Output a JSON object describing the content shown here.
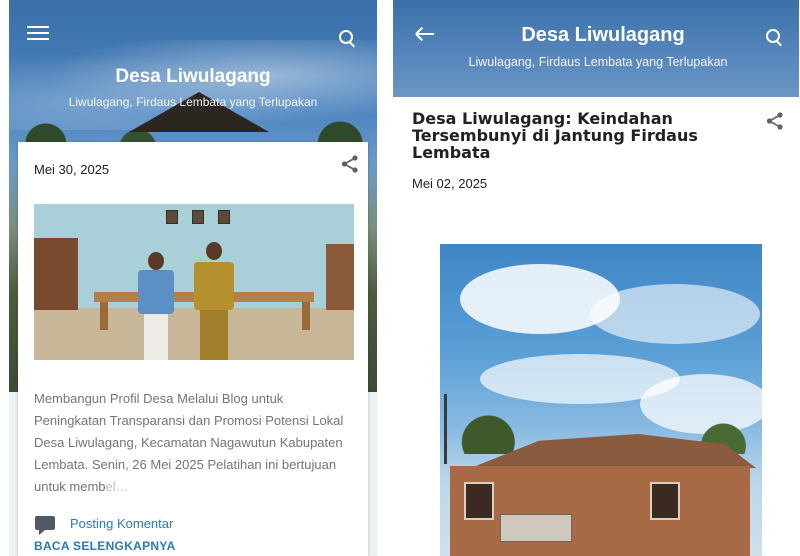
{
  "left": {
    "header": {
      "blog_title": "Desa Liwulagang",
      "tagline": "Liwulagang, Firdaus Lembata yang Terlupakan",
      "menu_icon": "hamburger-menu-icon",
      "search_icon": "search-icon"
    },
    "post": {
      "date": "Mei 30, 2025",
      "share_icon": "share-icon",
      "excerpt": "Membangun Profil Desa Melalui Blog untuk Peningkatan Transparansi dan Promosi Potensi Lokal Desa Liwulagang, Kecamatan Nagawutun Kabupaten Lembata. Senin, 26 Mei 2025  Pelatihan ini bertujuan untuk memb",
      "excerpt_fade": "el…",
      "comment_icon": "comment-icon",
      "comment_label": "Posting Komentar",
      "read_more_label": "BACA SELENGKAPNYA"
    }
  },
  "right": {
    "header": {
      "blog_title": "Desa Liwulagang",
      "tagline": "Liwulagang, Firdaus Lembata yang Terlupakan",
      "back_icon": "back-arrow-icon",
      "search_icon": "search-icon"
    },
    "article": {
      "title": "Desa Liwulagang: Keindahan Tersembunyi di Jantung Firdaus Lembata",
      "date": "Mei 02, 2025",
      "share_icon": "share-icon"
    }
  },
  "colors": {
    "link": "#2a7ab8",
    "header_blue": "#4b84bf",
    "text_dark": "#212121",
    "text_muted": "#757575"
  }
}
